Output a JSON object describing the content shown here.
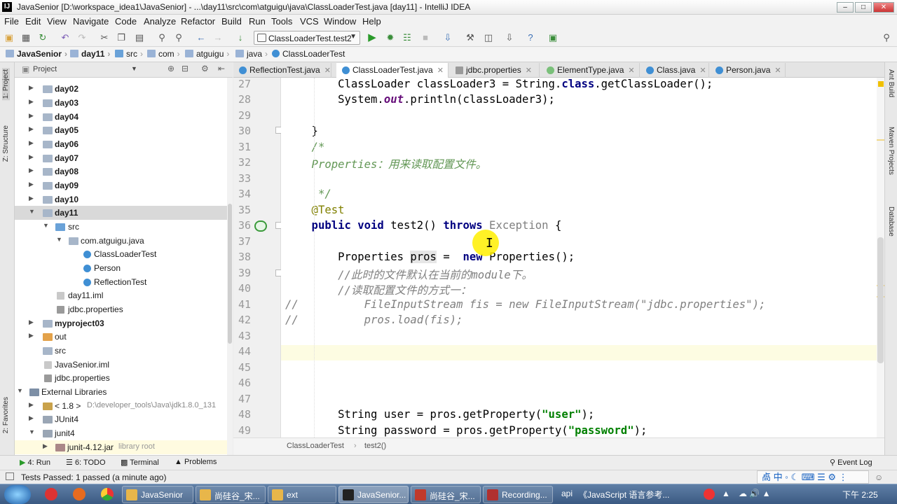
{
  "window": {
    "title": "JavaSenior [D:\\workspace_idea1\\JavaSenior] - ...\\day11\\src\\com\\atguigu\\java\\ClassLoaderTest.java [day11] - IntelliJ IDEA",
    "minimize": "–",
    "maximize": "□",
    "close": "✕"
  },
  "menu": [
    "File",
    "Edit",
    "View",
    "Navigate",
    "Code",
    "Analyze",
    "Refactor",
    "Build",
    "Run",
    "Tools",
    "VCS",
    "Window",
    "Help"
  ],
  "toolbar": {
    "run_config": "ClassLoaderTest.test2"
  },
  "breadcrumb": [
    "JavaSenior",
    "day11",
    "src",
    "com",
    "atguigu",
    "java",
    "ClassLoaderTest"
  ],
  "left_tool_tabs": {
    "project": "1: Project",
    "structure": "Z: Structure",
    "favorites": "2: Favorites"
  },
  "right_tool_tabs": {
    "ant": "Ant Build",
    "maven": "Maven Projects",
    "database": "Database"
  },
  "project_panel": {
    "title": "Project",
    "tree": [
      {
        "label": "day02",
        "bold": true
      },
      {
        "label": "day03",
        "bold": true
      },
      {
        "label": "day04",
        "bold": true
      },
      {
        "label": "day05",
        "bold": true
      },
      {
        "label": "day06",
        "bold": true
      },
      {
        "label": "day07",
        "bold": true
      },
      {
        "label": "day08",
        "bold": true
      },
      {
        "label": "day09",
        "bold": true
      },
      {
        "label": "day10",
        "bold": true
      },
      {
        "label": "day11",
        "bold": true
      },
      {
        "label": "src"
      },
      {
        "label": "com.atguigu.java"
      },
      {
        "label": "ClassLoaderTest"
      },
      {
        "label": "Person"
      },
      {
        "label": "ReflectionTest"
      },
      {
        "label": "day11.iml"
      },
      {
        "label": "jdbc.properties"
      },
      {
        "label": "myproject03",
        "bold": true
      },
      {
        "label": "out"
      },
      {
        "label": "src"
      },
      {
        "label": "JavaSenior.iml"
      },
      {
        "label": "jdbc.properties"
      },
      {
        "label": "External Libraries"
      },
      {
        "label": "< 1.8 >",
        "extra": "D:\\developer_tools\\Java\\jdk1.8.0_131"
      },
      {
        "label": "JUnit4"
      },
      {
        "label": "junit4"
      },
      {
        "label": "junit-4.12.jar",
        "extra": "library root"
      }
    ]
  },
  "editor_tabs": [
    {
      "label": "ReflectionTest.java"
    },
    {
      "label": "ClassLoaderTest.java",
      "active": true
    },
    {
      "label": "jdbc.properties"
    },
    {
      "label": "ElementType.java"
    },
    {
      "label": "Class.java"
    },
    {
      "label": "Person.java"
    }
  ],
  "code": {
    "line_numbers": [
      "27",
      "28",
      "29",
      "30",
      "31",
      "32",
      "33",
      "34",
      "35",
      "36",
      "37",
      "38",
      "39",
      "40",
      "41",
      "42",
      "43",
      "44",
      "45",
      "46",
      "47",
      "48",
      "49"
    ],
    "l27a": "        ClassLoader classLoader3 = String.",
    "l27b": "class",
    "l27c": ".getClassLoader();",
    "l28a": "        System.",
    "l28b": "out",
    "l28c": ".println(classLoader3);",
    "l30": "    }",
    "l31": "    /*",
    "l32": "    Properties：用来读取配置文件。",
    "l34": "     */",
    "l35": "    @Test",
    "l36a": "    public void",
    "l36b": " test2() ",
    "l36c": "throws",
    "l36d": " Exception",
    "l36e": " {",
    "l38a": "        Properties ",
    "l38b": "pros",
    "l38c": " =  ",
    "l38d": "new",
    "l38e": " Properties();",
    "l39": "        //此时的文件默认在当前的module下。",
    "l40": "        //读取配置文件的方式一：",
    "l41": "//          FileInputStream fis = new FileInputStream(\"jdbc.properties\");",
    "l42": "//          pros.load(fis);",
    "l48a": "        String user = pros.getProperty(",
    "l48b": "\"user\"",
    "l48c": ");",
    "l49a": "        String password = pros.getProperty(",
    "l49b": "\"password\"",
    "l49c": ");"
  },
  "editor_breadcrumb": {
    "cls": "ClassLoaderTest",
    "method": "test2()"
  },
  "tool_windows": {
    "run": "4: Run",
    "todo": "6: TODO",
    "terminal": "Terminal",
    "problems": "Problems",
    "event_log": "Event Log"
  },
  "status": {
    "message": "Tests Passed: 1 passed (a minute ago)"
  },
  "taskbar": {
    "items": [
      {
        "label": "JavaSenior",
        "color": "#e8b64a"
      },
      {
        "label": "尚硅谷_宋...",
        "color": "#e8b64a"
      },
      {
        "label": "ext",
        "color": "#e8b64a"
      },
      {
        "label": "JavaSenior...",
        "color": "#222222"
      },
      {
        "label": "尚硅谷_宋...",
        "color": "#c0392b"
      },
      {
        "label": "Recording...",
        "color": "#b03030"
      }
    ],
    "extra": [
      "api",
      "《JavaScript 语言参考..."
    ],
    "clock": "下午 2:25"
  },
  "colors": {
    "accent": "#3f8fd4",
    "comment": "#808080",
    "keyword": "#000080",
    "string": "#008000",
    "annotation": "#808000"
  }
}
